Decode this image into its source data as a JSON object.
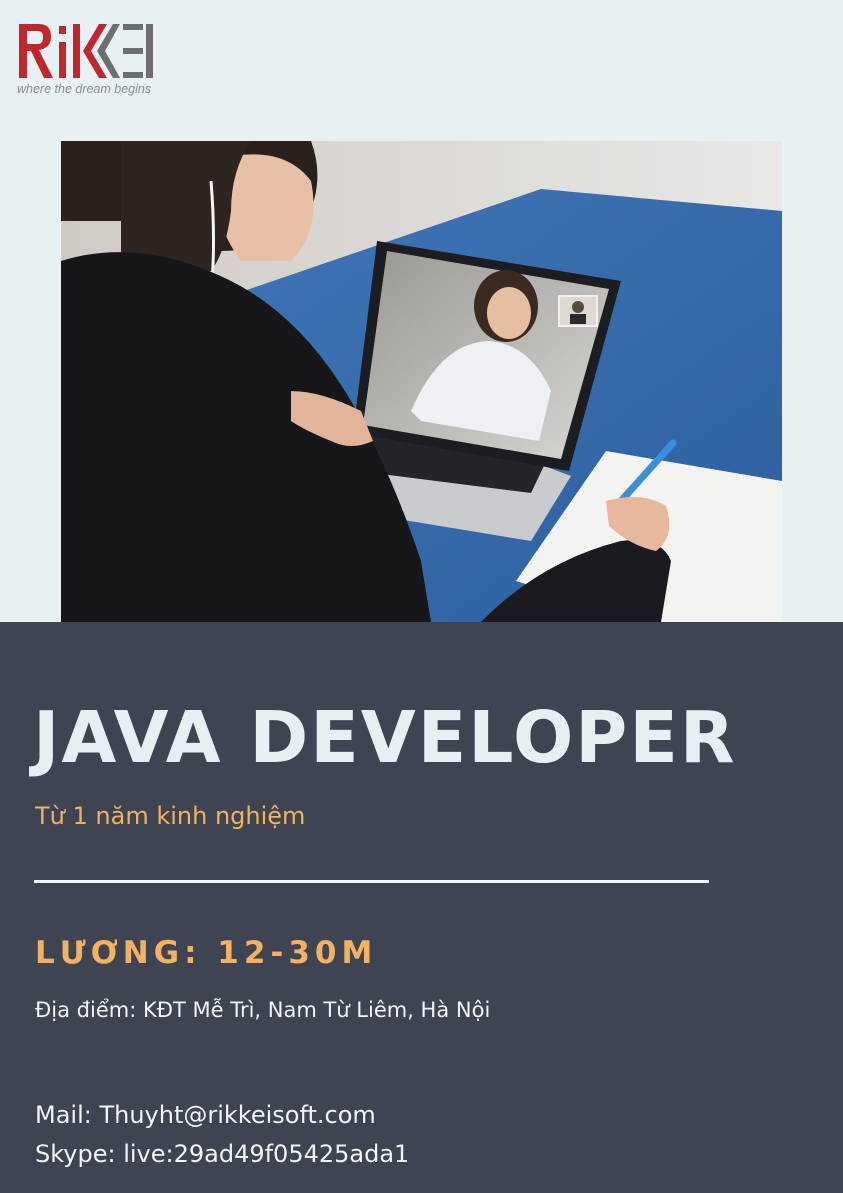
{
  "logo": {
    "brand": "RIKKEI",
    "tagline": "where the dream begins"
  },
  "colors": {
    "page_background": "#e7f1f3",
    "panel_background": "#3e4452",
    "accent_orange": "#f2b262",
    "logo_red": "#c0272d",
    "logo_gray": "#6d6e70",
    "text_light": "#f3f5f7"
  },
  "photo": {
    "description_icon": "video-call-photo"
  },
  "job": {
    "title": "JAVA DEVELOPER",
    "experience": "Từ 1 năm kinh nghiệm",
    "salary": "LƯƠNG: 12-30M",
    "location": "Địa điểm: KĐT Mễ Trì, Nam Từ Liêm, Hà Nội"
  },
  "contact": {
    "mail": "Mail: Thuyht@rikkeisoft.com",
    "skype": "Skype: live:29ad49f05425ada1"
  }
}
